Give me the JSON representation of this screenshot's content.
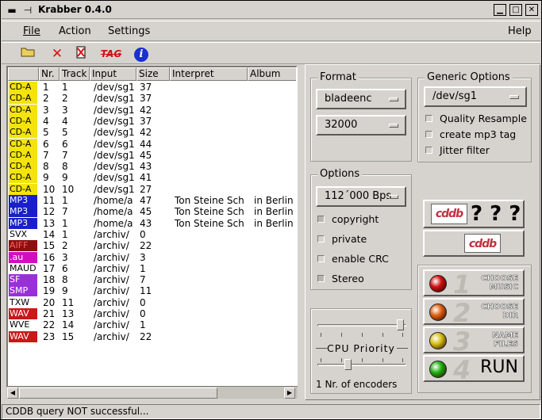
{
  "window": {
    "title": "Krabber 0.4.0"
  },
  "menu": {
    "file": "File",
    "action": "Action",
    "settings": "Settings",
    "help": "Help"
  },
  "toolbar": {
    "tag_label": "TAG",
    "info_label": "i"
  },
  "table": {
    "headers": [
      "",
      "Nr.",
      "Track",
      "Input",
      "Size",
      "Interpret",
      "Album"
    ],
    "rows": [
      {
        "fmt": "CD-A",
        "fmt_bg": "#f4e40c",
        "fmt_fg": "#000",
        "nr": "1",
        "track": "1",
        "input": "/dev/sg1",
        "size": "37",
        "interpret": "",
        "album": ""
      },
      {
        "fmt": "CD-A",
        "fmt_bg": "#f4e40c",
        "fmt_fg": "#000",
        "nr": "2",
        "track": "2",
        "input": "/dev/sg1",
        "size": "37",
        "interpret": "",
        "album": ""
      },
      {
        "fmt": "CD-A",
        "fmt_bg": "#f4e40c",
        "fmt_fg": "#000",
        "nr": "3",
        "track": "3",
        "input": "/dev/sg1",
        "size": "42",
        "interpret": "",
        "album": ""
      },
      {
        "fmt": "CD-A",
        "fmt_bg": "#f4e40c",
        "fmt_fg": "#000",
        "nr": "4",
        "track": "4",
        "input": "/dev/sg1",
        "size": "37",
        "interpret": "",
        "album": ""
      },
      {
        "fmt": "CD-A",
        "fmt_bg": "#f4e40c",
        "fmt_fg": "#000",
        "nr": "5",
        "track": "5",
        "input": "/dev/sg1",
        "size": "42",
        "interpret": "",
        "album": ""
      },
      {
        "fmt": "CD-A",
        "fmt_bg": "#f4e40c",
        "fmt_fg": "#000",
        "nr": "6",
        "track": "6",
        "input": "/dev/sg1",
        "size": "44",
        "interpret": "",
        "album": ""
      },
      {
        "fmt": "CD-A",
        "fmt_bg": "#f4e40c",
        "fmt_fg": "#000",
        "nr": "7",
        "track": "7",
        "input": "/dev/sg1",
        "size": "45",
        "interpret": "",
        "album": ""
      },
      {
        "fmt": "CD-A",
        "fmt_bg": "#f4e40c",
        "fmt_fg": "#000",
        "nr": "8",
        "track": "8",
        "input": "/dev/sg1",
        "size": "43",
        "interpret": "",
        "album": ""
      },
      {
        "fmt": "CD-A",
        "fmt_bg": "#f4e40c",
        "fmt_fg": "#000",
        "nr": "9",
        "track": "9",
        "input": "/dev/sg1",
        "size": "41",
        "interpret": "",
        "album": ""
      },
      {
        "fmt": "CD-A",
        "fmt_bg": "#f4e40c",
        "fmt_fg": "#000",
        "nr": "10",
        "track": "10",
        "input": "/dev/sg1",
        "size": "27",
        "interpret": "",
        "album": ""
      },
      {
        "fmt": "MP3",
        "fmt_bg": "#1a20c8",
        "fmt_fg": "#fff",
        "nr": "11",
        "track": "1",
        "input": "/home/a",
        "size": "47",
        "interpret": "Ton Steine Sch",
        "album": "in Berlin"
      },
      {
        "fmt": "MP3",
        "fmt_bg": "#1a20c8",
        "fmt_fg": "#fff",
        "nr": "12",
        "track": "7",
        "input": "/home/a",
        "size": "45",
        "interpret": "Ton Steine Sch",
        "album": "in Berlin"
      },
      {
        "fmt": "MP3",
        "fmt_bg": "#1a20c8",
        "fmt_fg": "#fff",
        "nr": "13",
        "track": "1",
        "input": "/home/a",
        "size": "43",
        "interpret": "Ton Steine Sch",
        "album": "in Berlin"
      },
      {
        "fmt": "SVX",
        "fmt_bg": "#ffffff",
        "fmt_fg": "#000",
        "nr": "14",
        "track": "1",
        "input": "/archiv/",
        "size": "0",
        "interpret": "",
        "album": ""
      },
      {
        "fmt": "AIFF",
        "fmt_bg": "#8a1010",
        "fmt_fg": "#ff6060",
        "nr": "15",
        "track": "2",
        "input": "/archiv/",
        "size": "22",
        "interpret": "",
        "album": ""
      },
      {
        "fmt": ".au",
        "fmt_bg": "#d010c0",
        "fmt_fg": "#fff",
        "nr": "16",
        "track": "3",
        "input": "/archiv/",
        "size": "3",
        "interpret": "",
        "album": ""
      },
      {
        "fmt": "MAUD",
        "fmt_bg": "#ffffff",
        "fmt_fg": "#000",
        "nr": "17",
        "track": "6",
        "input": "/archiv/",
        "size": "1",
        "interpret": "",
        "album": ""
      },
      {
        "fmt": "SF",
        "fmt_bg": "#9830d8",
        "fmt_fg": "#fff",
        "nr": "18",
        "track": "8",
        "input": "/archiv/",
        "size": "7",
        "interpret": "",
        "album": ""
      },
      {
        "fmt": "SMP",
        "fmt_bg": "#9830d8",
        "fmt_fg": "#fff",
        "nr": "19",
        "track": "9",
        "input": "/archiv/",
        "size": "11",
        "interpret": "",
        "album": ""
      },
      {
        "fmt": "TXW",
        "fmt_bg": "#ffffff",
        "fmt_fg": "#000",
        "nr": "20",
        "track": "11",
        "input": "/archiv/",
        "size": "0",
        "interpret": "",
        "album": ""
      },
      {
        "fmt": "WAV",
        "fmt_bg": "#c81818",
        "fmt_fg": "#fff",
        "nr": "21",
        "track": "13",
        "input": "/archiv/",
        "size": "0",
        "interpret": "",
        "album": ""
      },
      {
        "fmt": "WVE",
        "fmt_bg": "#ffffff",
        "fmt_fg": "#000",
        "nr": "22",
        "track": "14",
        "input": "/archiv/",
        "size": "1",
        "interpret": "",
        "album": ""
      },
      {
        "fmt": "WAV",
        "fmt_bg": "#c81818",
        "fmt_fg": "#fff",
        "nr": "23",
        "track": "15",
        "input": "/archiv/",
        "size": "22",
        "interpret": "",
        "album": ""
      }
    ]
  },
  "format_group": {
    "title": "Format",
    "encoder": "bladeenc",
    "bitrate": "32000"
  },
  "generic_group": {
    "title": "Generic Options",
    "device": "/dev/sg1",
    "checks": [
      {
        "label": "Quality Resample",
        "checked": false
      },
      {
        "label": "create mp3 tag",
        "checked": false
      },
      {
        "label": "Jitter filter",
        "checked": false
      }
    ]
  },
  "options_group": {
    "title": "Options",
    "bps": "112´000 Bps",
    "checks": [
      {
        "label": "copyright",
        "checked": true
      },
      {
        "label": "private",
        "checked": false
      },
      {
        "label": "enable CRC",
        "checked": false
      },
      {
        "label": "Stereo",
        "checked": true
      }
    ]
  },
  "cddb": {
    "logo_text": "cddb",
    "unknown": "? ? ?"
  },
  "run_buttons": [
    {
      "num": "1",
      "label": "CHOOSE MUSIC",
      "lamp": "#d01010"
    },
    {
      "num": "2",
      "label": "CHOOSE DIR",
      "lamp": "#e06010"
    },
    {
      "num": "3",
      "label": "NAME FILES",
      "lamp": "#d8c010"
    },
    {
      "num": "4",
      "label": "RUN",
      "lamp": "#20b010"
    }
  ],
  "priority": {
    "label": "CPU Priority",
    "value": 0.97
  },
  "encoders": {
    "label": "1 Nr. of encoders",
    "value": 0.33
  },
  "status": {
    "text": "CDDB query NOT successful..."
  }
}
